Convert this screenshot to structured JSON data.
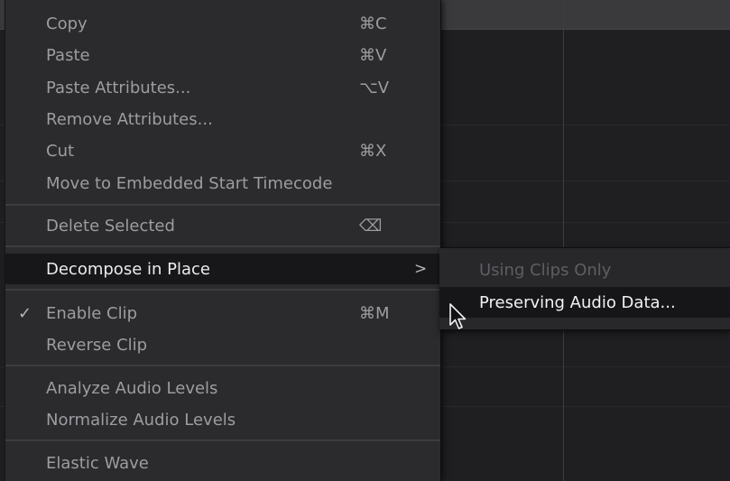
{
  "menu": {
    "items": [
      {
        "label": "Copy",
        "shortcut": "⌘C"
      },
      {
        "label": "Paste",
        "shortcut": "⌘V"
      },
      {
        "label": "Paste Attributes...",
        "shortcut": "⌥V"
      },
      {
        "label": "Remove Attributes...",
        "shortcut": ""
      },
      {
        "label": "Cut",
        "shortcut": "⌘X"
      },
      {
        "label": "Move to Embedded Start Timecode",
        "shortcut": ""
      },
      {
        "label": "Delete Selected",
        "shortcut": "⌫"
      },
      {
        "label": "Decompose in Place",
        "arrow": ">"
      },
      {
        "label": "Enable Clip",
        "shortcut": "⌘M",
        "check": "✓"
      },
      {
        "label": "Reverse Clip",
        "shortcut": ""
      },
      {
        "label": "Analyze Audio Levels",
        "shortcut": ""
      },
      {
        "label": "Normalize Audio Levels",
        "shortcut": ""
      },
      {
        "label": "Elastic Wave",
        "shortcut": ""
      }
    ]
  },
  "submenu": {
    "items": [
      {
        "label": "Using Clips Only",
        "state": "disabled"
      },
      {
        "label": "Preserving Audio Data...",
        "state": "highlighted"
      }
    ]
  },
  "colors": {
    "menu_bg": "#2b2b2e",
    "highlight_bg": "#17171a",
    "text": "#9d9da1",
    "text_highlight": "#ececee",
    "disabled_text": "#5e5e63"
  },
  "icons": {
    "check": "checkmark-icon",
    "submenu_arrow": "chevron-right-icon",
    "delete": "delete-key-icon",
    "cursor": "mouse-pointer-icon"
  }
}
